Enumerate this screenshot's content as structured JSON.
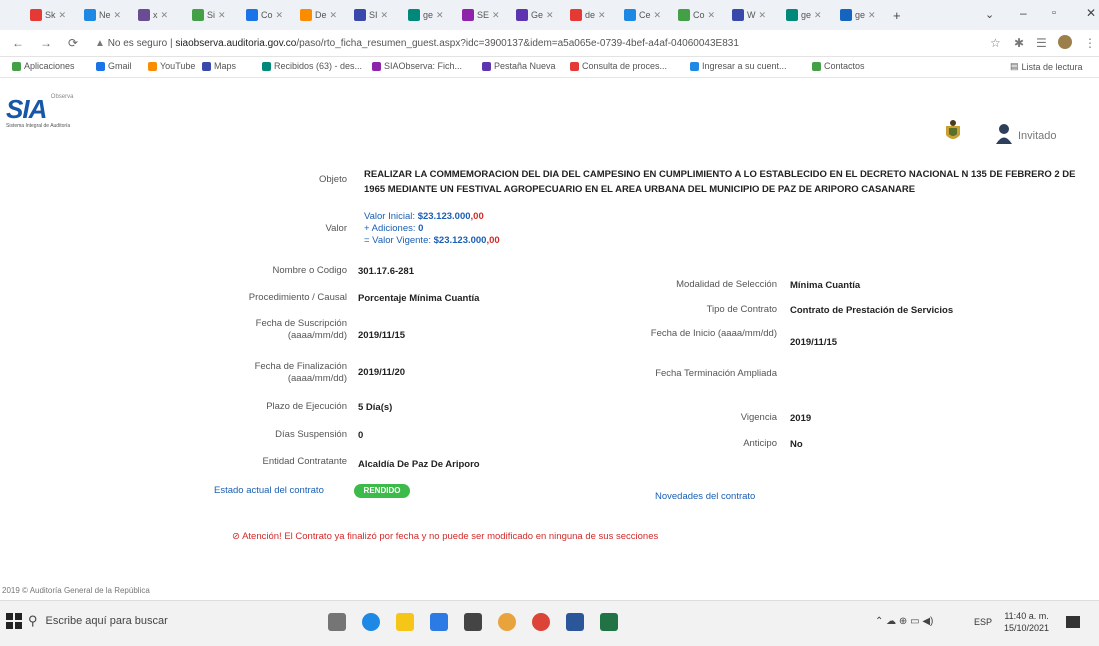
{
  "browser": {
    "tabs": [
      "Sk",
      "Ne",
      "x",
      "Si",
      "Co",
      "De",
      "SI",
      "ge",
      "SE",
      "Ge",
      "de",
      "Ce",
      "Co",
      "W",
      "ge",
      "ge"
    ],
    "url_prefix": "No es seguro",
    "url_host": "siaobserva.auditoria.gov.co",
    "url_path": "/paso/rto_ficha_resumen_guest.aspx?idc=3900137&idem=a5a065e-0739-4bef-a4af-04060043E831",
    "bookmarks": [
      "Aplicaciones",
      "Gmail",
      "YouTube",
      "Maps",
      "Recibidos (63) - des...",
      "SIAObserva: Fich...",
      "Pestaña Nueva",
      "Consulta de proces...",
      "Ingresar a su cuent...",
      "Contactos"
    ],
    "reading_list": "Lista de lectura"
  },
  "header": {
    "logo": "SIA",
    "logo_sub": "Observa",
    "logo_caption": "Sistema Integral de Auditoría",
    "user": "Invitado"
  },
  "contract": {
    "objeto_label": "Objeto",
    "objeto": "REALIZAR LA COMMEMORACION DEL DIA DEL CAMPESINO EN CUMPLIMIENTO A LO ESTABLECIDO EN EL DECRETO NACIONAL N 135 DE FEBRERO 2 DE 1965 MEDIANTE UN FESTIVAL AGROPECUARIO EN EL AREA URBANA DEL MUNICIPIO DE PAZ DE ARIPORO CASANARE",
    "valor_label": "Valor",
    "valor_inicial_label": "Valor Inicial:",
    "valor_inicial": "$23.123.000",
    "valor_inicial_dec": ",00",
    "adiciones_label": "+ Adiciones:",
    "adiciones": "0",
    "valor_vigente_label": "= Valor Vigente:",
    "valor_vigente": "$23.123.000",
    "valor_vigente_dec": ",00",
    "left": [
      {
        "label": "Nombre o Codigo",
        "value": "301.17.6-281"
      },
      {
        "label": "Procedimiento / Causal",
        "value": "Porcentaje Mínima Cuantía"
      },
      {
        "label": "Fecha de Suscripción (aaaa/mm/dd)",
        "value": "2019/11/15"
      },
      {
        "label": "Fecha de Finalización (aaaa/mm/dd)",
        "value": "2019/11/20"
      },
      {
        "label": "Plazo de Ejecución",
        "value": "5 Día(s)"
      },
      {
        "label": "Días Suspensión",
        "value": "0"
      },
      {
        "label": "Entidad Contratante",
        "value": "Alcaldía De Paz De Ariporo"
      }
    ],
    "right": [
      {
        "label": "Modalidad de Selección",
        "value": "Mínima Cuantía"
      },
      {
        "label": "Tipo de Contrato",
        "value": "Contrato de Prestación de Servicios"
      },
      {
        "label": "Fecha de Inicio (aaaa/mm/dd)",
        "value": "2019/11/15"
      },
      {
        "label": "Fecha Terminación Ampliada",
        "value": ""
      },
      {
        "label": "Vigencia",
        "value": "2019"
      },
      {
        "label": "Anticipo",
        "value": "No"
      }
    ],
    "estado_label": "Estado actual del contrato",
    "estado": "RENDIDO",
    "novedades": "Novedades del contrato",
    "warning": "Atención! El Contrato ya finalizó por fecha y no puede ser modificado en ninguna de sus secciones"
  },
  "footer": "2019 © Auditoría General de la República",
  "taskbar": {
    "search_placeholder": "Escribe aquí para buscar",
    "lang": "ESP",
    "time": "11:40 a. m.",
    "date": "15/10/2021"
  },
  "colors": {
    "accent": "#1a5fb4",
    "badge": "#3dbb4a",
    "warning": "#d32a2a"
  }
}
